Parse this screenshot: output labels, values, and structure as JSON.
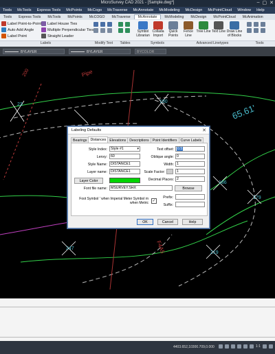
{
  "window": {
    "title": "MicroSurvey CAD 2021 - [Sample.dwg*]",
    "controls": [
      "–",
      "▢",
      "✕"
    ]
  },
  "menubar": [
    "Tools",
    "McTools",
    "Express Tools",
    "McPoints",
    "McCogo",
    "McTraverse",
    "McAnnotate",
    "McModeling",
    "McDesign",
    "McPointCloud",
    "Window",
    "Help"
  ],
  "ribbon_tabs": {
    "items": [
      "Tools",
      "Express Tools",
      "McTools",
      "McPoints",
      "McCOGO",
      "McTraverse",
      "McAnnotate",
      "McModeling",
      "McDesign",
      "McPointCloud",
      "McAnimation"
    ],
    "active": "McAnnotate"
  },
  "ribbon": {
    "labels_group": {
      "items": [
        "Label Point-to-Point",
        "Label House Ties",
        "Auto Add Angle",
        "Multiple Perpendicular Ties",
        "Label Point",
        "Straight Leader"
      ],
      "label": "Labels"
    },
    "groups": [
      "Modify Text",
      "Tables",
      "Symbols",
      "Advanced Linetypes",
      "Tools"
    ],
    "big_buttons": [
      {
        "label": "Symbol Librarian",
        "color": "#3a78c6"
      },
      {
        "label": "Collada Import",
        "color": "#c0392b"
      },
      {
        "label": "Quick Points",
        "color": "#6b7f99"
      },
      {
        "label": "Fence Line",
        "color": "#8c5a2a"
      },
      {
        "label": "Tree Line",
        "color": "#2e8b3e"
      },
      {
        "label": "Text Line",
        "color": "#555555"
      },
      {
        "label": "Draw Line of Blocks",
        "color": "#3a6ea5"
      }
    ]
  },
  "properties_bar": {
    "layer_color": "BYLAYER",
    "linetype": "BYLAYER",
    "lineweight": "BYCOLOR"
  },
  "drawing": {
    "labels": [
      "Pipe",
      "65.61'",
      "F4A5",
      "200"
    ],
    "colors": {
      "line_green": "#33d24a",
      "label_cyan": "#48b9c9",
      "label_red": "#c23b3b",
      "magenta": "#c040c0"
    }
  },
  "dialog": {
    "title": "Labeling Defaults",
    "close": "✕",
    "tabs": [
      "Bearings",
      "Distances",
      "Elevations",
      "Descriptions",
      "Point Identifiers",
      "Curve Labels"
    ],
    "active_tab": "Distances",
    "fields": {
      "style_index_label": "Style Index:",
      "style_index_value": "Style #1",
      "lenxy_label": "Lenxy:",
      "lenxy_value": "60",
      "style_name_label": "Style Name:",
      "style_name_value": "DISTANCE1",
      "layer_name_label": "Layer name:",
      "layer_name_value": "DISTANCE1",
      "layer_color_button": "Layer Color",
      "layer_color": "#00d400",
      "font_file_label": "Font file name:",
      "font_file_value": "MSURVEY.SHX",
      "browse_button": "Browse",
      "text_offset_label": "Text offset:",
      "text_offset_value": "0.5",
      "oblique_label": "Oblique angle:",
      "oblique_value": "0",
      "width_label": "Width:",
      "width_value": "1",
      "scale_factor_label": "Scale Factor:",
      "scale_factor_value": "1",
      "decimal_places_label": "Decimal Places:",
      "decimal_places_value": "2",
      "foot_symbol_text": "Foot Symbol ' when Imperial Meter Symbol m when Metric",
      "foot_symbol_checked": "✓",
      "prefix_label": "Prefix:",
      "prefix_value": "",
      "suffix_label": "Suffix:",
      "suffix_value": ""
    },
    "buttons": {
      "ok": "OK",
      "cancel": "Cancel",
      "help": "Help"
    }
  },
  "status": {
    "coords": "4403.652,10300.709,0.000",
    "scale": "1:1"
  }
}
